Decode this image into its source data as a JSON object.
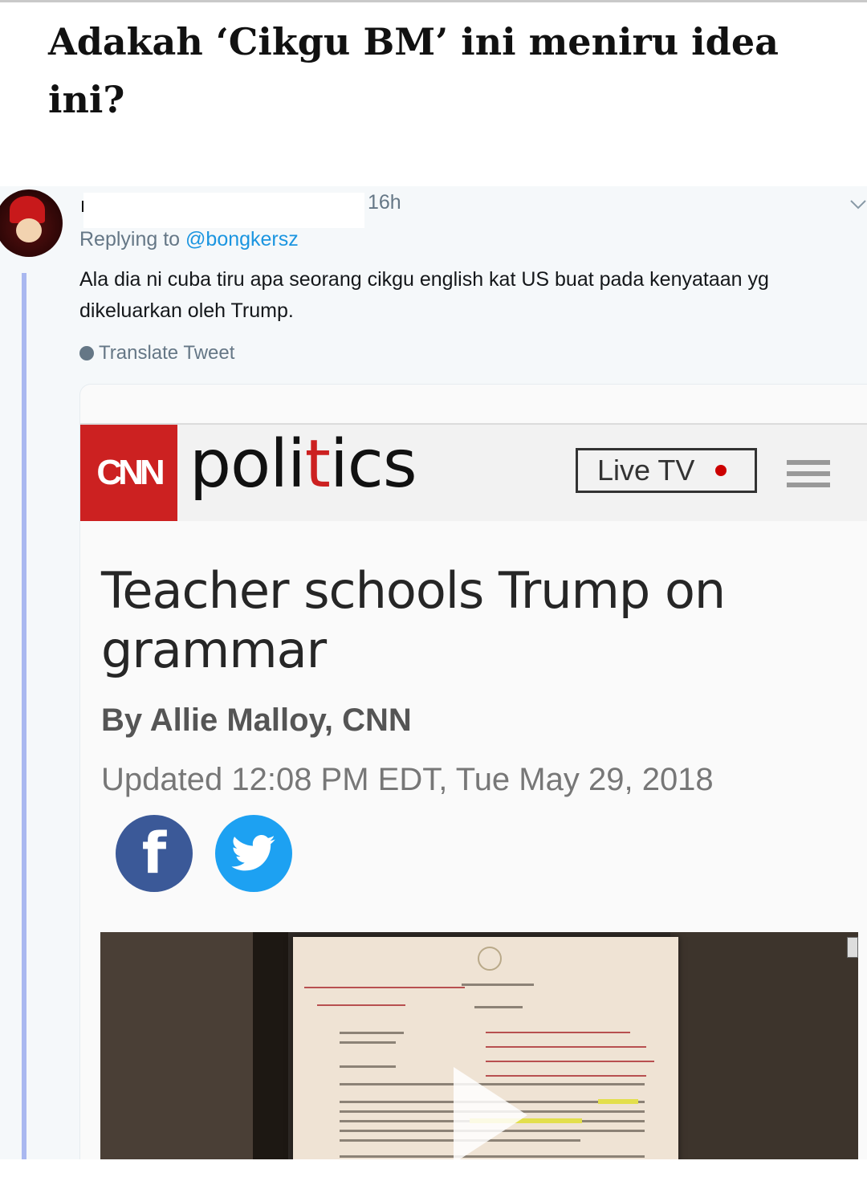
{
  "article": {
    "title": "Adakah ‘Cikgu BM’ ini meniru idea ini?"
  },
  "tweet": {
    "time": "16h",
    "replying_prefix": "Replying to ",
    "replying_handle": "@bongkersz",
    "text": "Ala dia ni cuba tiru apa seorang cikgu english kat US buat pada kenyataan yg dikeluarkan oleh Trump.",
    "translate_label": "Translate Tweet",
    "icons": [
      "avatar",
      "globe-icon",
      "chevron-down-icon"
    ]
  },
  "card": {
    "brand_logo": "CNN",
    "brand_section": "politics",
    "live_tv_label": "Live TV",
    "headline": "Teacher schools Trump on grammar",
    "byline": "By Allie Malloy, CNN",
    "updated": "Updated 12:08 PM EDT, Tue May 29, 2018",
    "share_facebook_glyph": "f",
    "icons": [
      "facebook-icon",
      "twitter-icon",
      "menu-icon",
      "play-icon"
    ],
    "colors": {
      "cnn_red": "#cc2121",
      "facebook": "#3b5998",
      "twitter": "#1da1f2",
      "link": "#1b95e0",
      "thread_line": "#a9b8f0"
    }
  }
}
